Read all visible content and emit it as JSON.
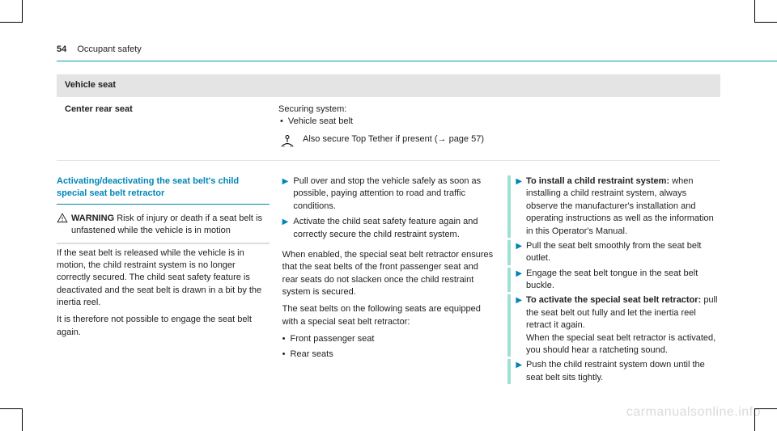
{
  "header": {
    "page_number": "54",
    "section": "Occupant safety"
  },
  "table": {
    "header": "Vehicle seat",
    "row": {
      "label": "Center rear seat",
      "securing_label": "Securing system:",
      "bullet": "Vehicle seat belt",
      "tether_text": "Also secure Top Tether if present (→ page 57)"
    }
  },
  "col1": {
    "heading": "Activating/deactivating the seat belt's child special seat belt retractor",
    "warning_label": "WARNING",
    "warning_title": "Risk of injury or death if a seat belt is unfastened while the vehicle is in motion",
    "warning_p1": "If the seat belt is released while the vehicle is in motion, the child restraint system is no longer correctly secured. The child seat safety feature is deactivated and the seat belt is drawn in a bit by the inertia reel.",
    "warning_p2": "It is therefore not possible to engage the seat belt again."
  },
  "col2": {
    "step1": "Pull over and stop the vehicle safely as soon as possible, paying attention to road and traffic conditions.",
    "step2": "Activate the child seat safety feature again and correctly secure the child restraint system.",
    "p1": "When enabled, the special seat belt retractor ensures that the seat belts of the front passenger seat and rear seats do not slacken once the child restraint system is secured.",
    "p2": "The seat belts on the following seats are equipped with a special seat belt retractor:",
    "b1": "Front passenger seat",
    "b2": "Rear seats"
  },
  "col3": {
    "s1_bold": "To install a child restraint system:",
    "s1_rest": " when installing a child restraint system, always observe the manufacturer's installation and operating instructions as well as the information in this Operator's Manual.",
    "s2": "Pull the seat belt smoothly from the seat belt outlet.",
    "s3": "Engage the seat belt tongue in the seat belt buckle.",
    "s4_bold": "To activate the special seat belt retractor:",
    "s4_rest": " pull the seat belt out fully and let the inertia reel retract it again.",
    "s4_tail": "When the special seat belt retractor is activated, you should hear a ratcheting sound.",
    "s5": "Push the child restraint system down until the seat belt sits tightly."
  },
  "watermark": "carmanualsonline.info"
}
